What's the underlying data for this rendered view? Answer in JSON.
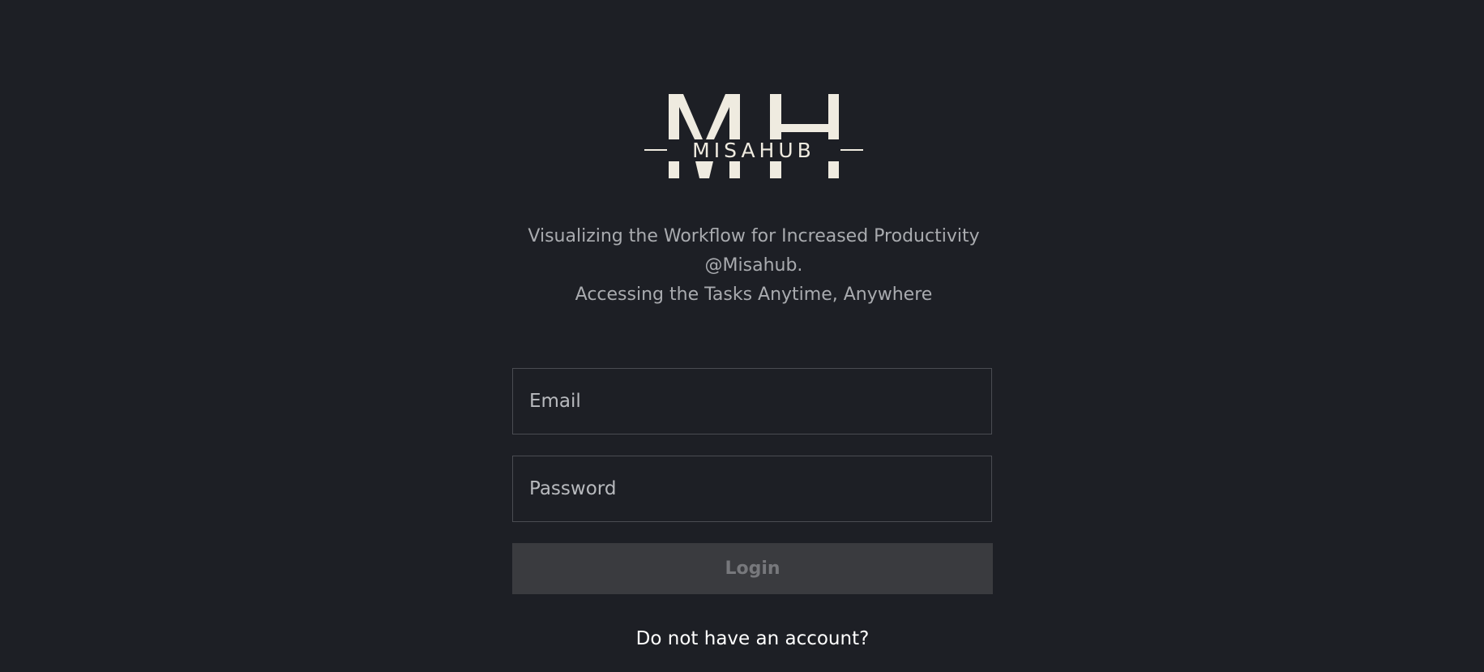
{
  "brand": {
    "logo_monogram": "MH",
    "logo_wordmark": "MISAHUB",
    "logo_color": "#efebe0"
  },
  "tagline": {
    "line1": "Visualizing the Workflow for Increased Productivity",
    "line2": "@Misahub.",
    "line3": "Accessing the Tasks Anytime, Anywhere"
  },
  "form": {
    "email_placeholder": "Email",
    "email_value": "",
    "password_placeholder": "Password",
    "password_value": "",
    "login_label": "Login",
    "signup_link": "Do not have an account?"
  },
  "colors": {
    "background": "#1d1f25",
    "button_bg": "#3a3b3f",
    "button_text": "#77787c",
    "text_muted": "#a9abaf"
  }
}
